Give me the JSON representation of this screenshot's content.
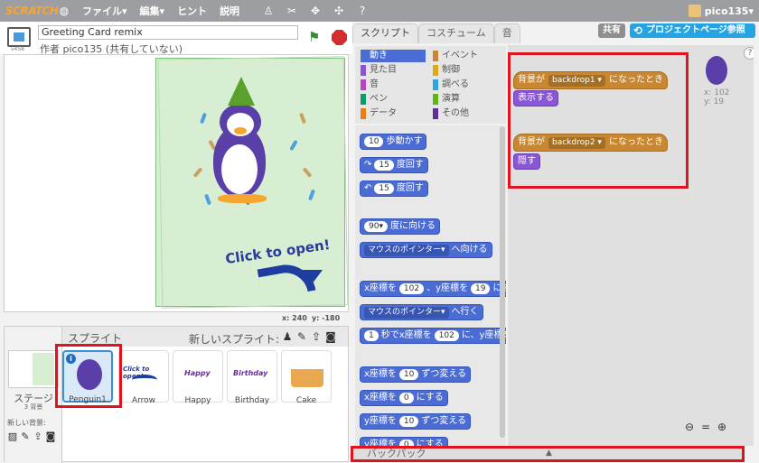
{
  "topbar": {
    "logo": "SCRATCH",
    "menu": [
      "ファイル▾",
      "編集▾",
      "ヒント",
      "説明"
    ],
    "user": "pico135▾"
  },
  "stage": {
    "version": "v458",
    "title": "Greeting Card remix",
    "author": "作者 pico135 (共有していない)",
    "card_text": "Click to open!",
    "coords_x": "x: 240",
    "coords_y": "y: -180"
  },
  "sprites": {
    "header": "スプライト",
    "new_sprite": "新しいスプライト:",
    "stage_label": "ステージ",
    "stage_count": "3 背景",
    "new_backdrop": "新しい背景:",
    "items": [
      {
        "name": "Penguin1",
        "selected": true
      },
      {
        "name": "Arrow",
        "text": "Click to open!"
      },
      {
        "name": "Happy",
        "text": "Happy"
      },
      {
        "name": "Birthday",
        "text": "Birthday"
      },
      {
        "name": "Cake"
      }
    ]
  },
  "tabs": [
    "スクリプト",
    "コスチューム",
    "音"
  ],
  "buttons": {
    "share": "共有",
    "project_page": "プロジェクトページ参照"
  },
  "categories": [
    {
      "label": "動き",
      "color": "#4a6cd4",
      "active": true
    },
    {
      "label": "イベント",
      "color": "#c88730"
    },
    {
      "label": "見た目",
      "color": "#8a55d7"
    },
    {
      "label": "制御",
      "color": "#e1a91a"
    },
    {
      "label": "音",
      "color": "#bb42c3"
    },
    {
      "label": "調べる",
      "color": "#2ca5e2"
    },
    {
      "label": "ペン",
      "color": "#0e9a6c"
    },
    {
      "label": "演算",
      "color": "#5cb712"
    },
    {
      "label": "データ",
      "color": "#ee7d16"
    },
    {
      "label": "その他",
      "color": "#632d99"
    }
  ],
  "palette_blocks": [
    {
      "parts": [
        "10",
        "歩動かす"
      ]
    },
    {
      "parts": [
        "↷",
        "15",
        "度回す"
      ]
    },
    {
      "parts": [
        "↶",
        "15",
        "度回す"
      ]
    },
    {
      "parts": [
        "90▾",
        "度に向ける"
      ]
    },
    {
      "parts": [
        "マウスのポインター▾",
        "へ向ける"
      ]
    },
    {
      "parts": [
        "x座標を",
        "102",
        "、y座標を",
        "19",
        "にする"
      ]
    },
    {
      "parts": [
        "マウスのポインター▾",
        "へ行く"
      ]
    },
    {
      "parts": [
        "1",
        "秒でx座標を",
        "102",
        "に、y座標を"
      ]
    },
    {
      "parts": [
        "x座標を",
        "10",
        "ずつ変える"
      ]
    },
    {
      "parts": [
        "x座標を",
        "0",
        "にする"
      ]
    },
    {
      "parts": [
        "y座標を",
        "10",
        "ずつ変える"
      ]
    },
    {
      "parts": [
        "y座標を",
        "0",
        "にする"
      ]
    }
  ],
  "scripts": [
    {
      "hat": "背景が",
      "backdrop": "backdrop1",
      "suffix": "になったとき",
      "action": "表示する"
    },
    {
      "hat": "背景が",
      "backdrop": "backdrop2",
      "suffix": "になったとき",
      "action": "隠す"
    }
  ],
  "sprite_info": {
    "x": "x: 102",
    "y": "y: 19"
  },
  "backpack": "バックパック",
  "colors": {
    "highlight": "#e0141e",
    "motion": "#4a6cd4",
    "events": "#c88730",
    "looks": "#8a55d7"
  }
}
